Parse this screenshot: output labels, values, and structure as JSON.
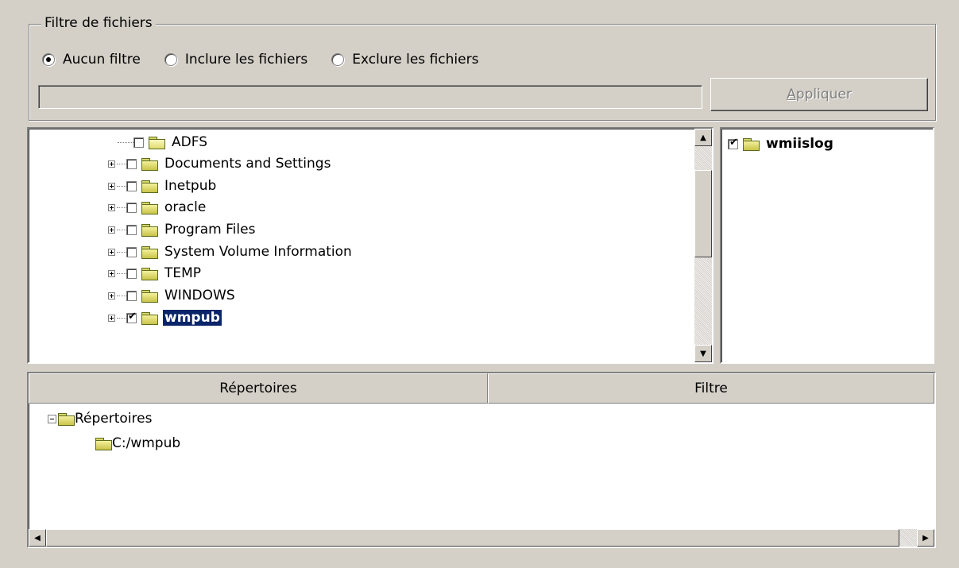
{
  "filter_group": {
    "legend": "Filtre de fichiers",
    "options": [
      {
        "label": "Aucun filtre",
        "selected": true
      },
      {
        "label": "Inclure les fichiers",
        "selected": false
      },
      {
        "label": "Exclure les fichiers",
        "selected": false
      }
    ],
    "input_value": "",
    "apply_button": {
      "label": "Appliquer",
      "accesskey": "A",
      "rest": "ppliquer",
      "enabled": false
    }
  },
  "tree": {
    "items": [
      {
        "label": "ADFS",
        "checked": false,
        "open": true,
        "expandable": false,
        "selected": false
      },
      {
        "label": "Documents and Settings",
        "checked": false,
        "expandable": true,
        "selected": false
      },
      {
        "label": "Inetpub",
        "checked": false,
        "expandable": true,
        "selected": false
      },
      {
        "label": "oracle",
        "checked": false,
        "expandable": true,
        "selected": false
      },
      {
        "label": "Program Files",
        "checked": false,
        "expandable": true,
        "selected": false
      },
      {
        "label": "System Volume Information",
        "checked": false,
        "expandable": true,
        "selected": false
      },
      {
        "label": "TEMP",
        "checked": false,
        "expandable": true,
        "selected": false
      },
      {
        "label": "WINDOWS",
        "checked": false,
        "expandable": true,
        "selected": false
      },
      {
        "label": "wmpub",
        "checked": true,
        "expandable": true,
        "selected": true
      }
    ]
  },
  "subfolders": {
    "items": [
      {
        "label": "wmiislog",
        "checked": true
      }
    ]
  },
  "result_list": {
    "columns": [
      "Répertoires",
      "Filtre"
    ],
    "root": "Répertoires",
    "entries": [
      {
        "path": "C:/wmpub",
        "filter": ""
      }
    ]
  },
  "colors": {
    "face": "#d4d0c8",
    "selection": "#0a246a"
  }
}
